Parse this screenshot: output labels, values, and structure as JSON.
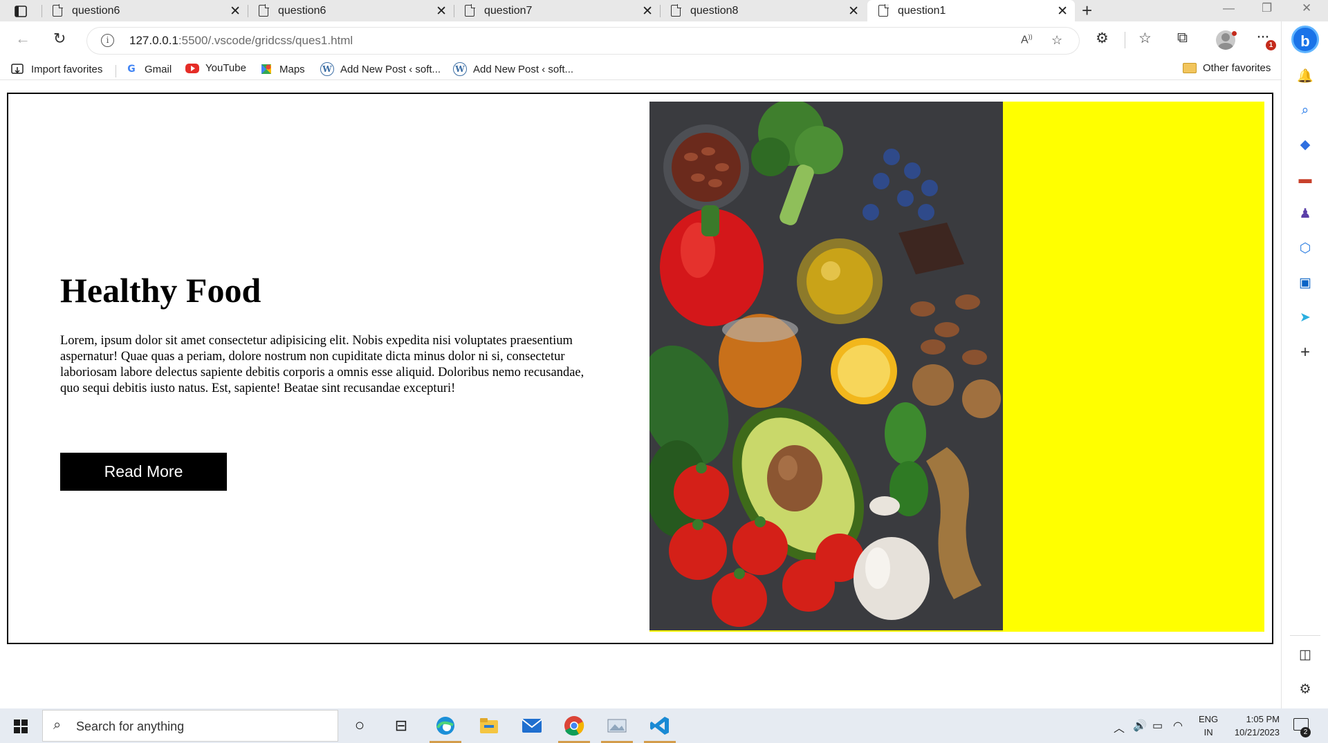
{
  "browser": {
    "tabs": [
      {
        "title": "question6",
        "active": false
      },
      {
        "title": "question6",
        "active": false
      },
      {
        "title": "question7",
        "active": false
      },
      {
        "title": "question8",
        "active": false
      },
      {
        "title": "question1",
        "active": true
      }
    ],
    "new_tab_label": "+",
    "window_controls": {
      "minimize": "—",
      "restore": "❐",
      "close": "✕"
    },
    "address": {
      "host": "127.0.0.1",
      "rest": ":5500/.vscode/gridcss/ques1.html"
    },
    "profile_badge": "1",
    "favorites": [
      {
        "label": "Import favorites",
        "icon": "import-icon"
      },
      {
        "label": "Gmail",
        "icon": "google-icon"
      },
      {
        "label": "YouTube",
        "icon": "youtube-icon"
      },
      {
        "label": "Maps",
        "icon": "maps-icon"
      },
      {
        "label": "Add New Post ‹ soft...",
        "icon": "wordpress-icon"
      },
      {
        "label": "Add New Post ‹ soft...",
        "icon": "wordpress-icon"
      }
    ],
    "other_favorites": "Other favorites"
  },
  "page": {
    "heading": "Healthy Food",
    "body": "Lorem, ipsum dolor sit amet consectetur adipisicing elit. Nobis expedita nisi voluptates praesentium aspernatur! Quae quas a periam, dolore nostrum non cupiditate dicta minus dolor ni si, consectetur laboriosam labore delectus sapiente debitis corporis a omnis esse aliquid. Doloribus nemo recusandae, quo sequi debitis iusto natus. Est, sapiente! Beatae sint recusandae excepturi!",
    "button": "Read More",
    "image": "vegetables-photo",
    "colors": {
      "accent_column": "#ffff00",
      "button_bg": "#000000",
      "image_bg": "#3b3c40"
    }
  },
  "taskbar": {
    "search_placeholder": "Search for anything",
    "lang_top": "ENG",
    "lang_bottom": "IN",
    "time": "1:05 PM",
    "date": "10/21/2023",
    "notification_count": "2"
  }
}
